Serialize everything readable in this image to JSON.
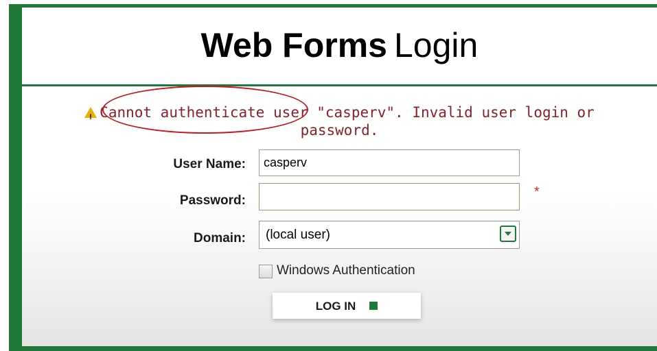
{
  "header": {
    "title_bold": "Web Forms",
    "title_light": "Login"
  },
  "error": {
    "icon": "warning-icon",
    "message": "Cannot authenticate user \"casperv\". Invalid user login or password."
  },
  "form": {
    "username": {
      "label": "User Name:",
      "value": "casperv"
    },
    "password": {
      "label": "Password:",
      "value": "",
      "required_marker": "*"
    },
    "domain": {
      "label": "Domain:",
      "selected": "(local user)"
    },
    "windows_auth": {
      "label": "Windows Authentication",
      "checked": false
    },
    "login_button_label": "LOG IN"
  },
  "colors": {
    "brand_green": "#1f7a3a",
    "error_text": "#8b1f2a",
    "annotation_red": "#c4161c",
    "required_red": "#d9262c"
  }
}
